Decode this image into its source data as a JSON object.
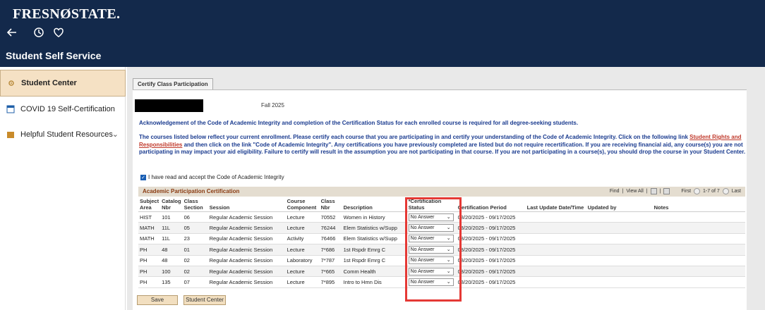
{
  "header": {
    "logo": "FRESNØSTATE.",
    "title": "Student Self Service",
    "icons": [
      "back-arrow-icon",
      "history-clock-icon",
      "favorite-heart-icon"
    ]
  },
  "sidebar": {
    "items": [
      {
        "label": "Student Center",
        "icon": "gear-icon",
        "active": true
      },
      {
        "label": "COVID 19 Self-Certification",
        "icon": "form-icon",
        "active": false
      },
      {
        "label": "Helpful Student Resources",
        "icon": "folder-icon",
        "active": false,
        "expandable": true
      }
    ]
  },
  "main": {
    "tab_label": "Certify Class Participation",
    "term": "Fall 2025",
    "ack_line1": "Acknowledgement of the Code of Academic Integrity and completion of the Certification Status for each enrolled course is required for all degree-seeking students.",
    "ack_line2_part1": "The courses listed below reflect your current enrollment. Please certify each course that you are participating in and certify your understanding of the Code of Academic Integrity. Click on the following link ",
    "ack_link": "Student Rights and Responsibilities",
    "ack_line2_part2": " and then click on the link \"Code of Academic Integrity\". Any certifications you have previously completed are listed but do not require recertification. If you are receiving financial aid, any course(s) you are not participating in may impact your aid eligibility. Failure to certify will result in the assumption you are not participating in that course. If you are not participating in a course(s), you should drop the course in your Student Center.",
    "checkbox_label": "I have read and accept the Code of Academic Integrity",
    "checkbox_checked": true
  },
  "grid": {
    "title": "Academic Participation Certification",
    "nav_find": "Find",
    "nav_viewall": "View All",
    "nav_first": "First",
    "nav_range": "1-7 of 7",
    "nav_last": "Last",
    "columns": [
      "Subject Area",
      "Catalog Nbr",
      "Class Section",
      "Session",
      "Course Component",
      "Class Nbr",
      "Description",
      "*Certification Status",
      "Certification Period",
      "Last Update Date/Time",
      "Updated by",
      "Notes"
    ],
    "rows": [
      {
        "subject": "HIST",
        "catalog": "101",
        "section": "06",
        "session": "Regular Academic Session",
        "component": "Lecture",
        "class_nbr": "70552",
        "description": "Women in History",
        "status": "No Answer",
        "period": "08/20/2025 - 09/17/2025"
      },
      {
        "subject": "MATH",
        "catalog": "11L",
        "section": "05",
        "session": "Regular Academic Session",
        "component": "Lecture",
        "class_nbr": "76244",
        "description": "Elem Statistics w/Supp",
        "status": "No Answer",
        "period": "08/20/2025 - 09/17/2025"
      },
      {
        "subject": "MATH",
        "catalog": "11L",
        "section": "23",
        "session": "Regular Academic Session",
        "component": "Activity",
        "class_nbr": "76466",
        "description": "Elem Statistics w/Supp",
        "status": "No Answer",
        "period": "08/20/2025 - 09/17/2025"
      },
      {
        "subject": "PH",
        "catalog": "48",
        "section": "01",
        "session": "Regular Academic Session",
        "component": "Lecture",
        "class_nbr": "7*686",
        "description": "1st Rspdr Emrg C",
        "status": "No Answer",
        "period": "08/20/2025 - 09/17/2025"
      },
      {
        "subject": "PH",
        "catalog": "48",
        "section": "02",
        "session": "Regular Academic Session",
        "component": "Laboratory",
        "class_nbr": "7*787",
        "description": "1st Rspdr Emrg C",
        "status": "No Answer",
        "period": "08/20/2025 - 09/17/2025"
      },
      {
        "subject": "PH",
        "catalog": "100",
        "section": "02",
        "session": "Regular Academic Session",
        "component": "Lecture",
        "class_nbr": "7*665",
        "description": "Comm Health",
        "status": "No Answer",
        "period": "08/20/2025 - 09/17/2025"
      },
      {
        "subject": "PH",
        "catalog": "135",
        "section": "07",
        "session": "Regular Academic Session",
        "component": "Lecture",
        "class_nbr": "7*895",
        "description": "Intro to Hmn Dis",
        "status": "No Answer",
        "period": "08/20/2025 - 09/17/2025"
      }
    ]
  },
  "buttons": {
    "save": "Save",
    "student_center": "Student Center"
  },
  "colors": {
    "header_bg": "#13294b",
    "active_side_bg": "#f5e1c4",
    "ack_text": "#1a3b8f",
    "highlight_box": "#e53935"
  }
}
